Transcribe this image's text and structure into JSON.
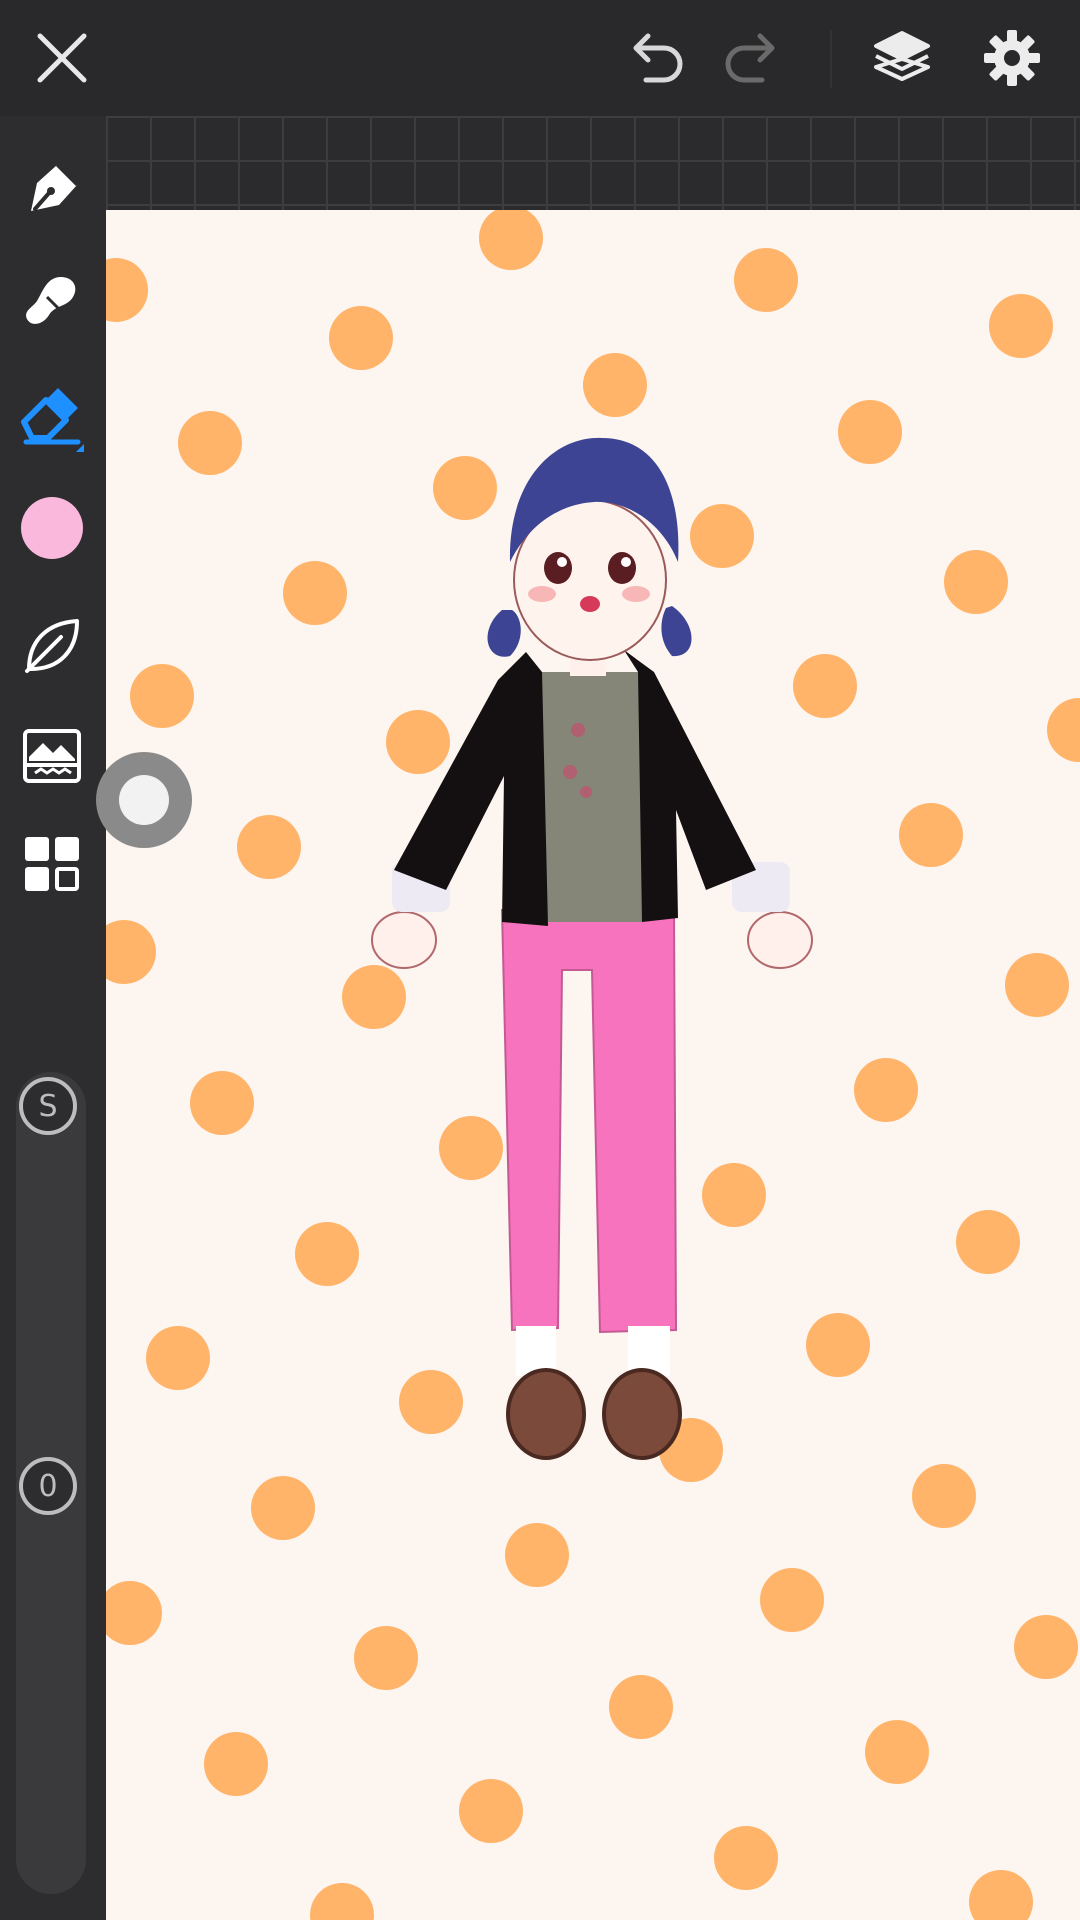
{
  "topbar": {
    "close_icon": "close-icon",
    "undo_icon": "undo-icon",
    "redo_icon": "redo-icon",
    "layers_icon": "layers-icon",
    "settings_icon": "gear-icon"
  },
  "tools": [
    {
      "name": "pen",
      "icon": "pen-icon"
    },
    {
      "name": "smudge",
      "icon": "smudge-icon"
    },
    {
      "name": "eraser",
      "icon": "eraser-icon",
      "selected": true
    },
    {
      "name": "color",
      "icon": "color-swatch",
      "color": "#f9b8dc"
    },
    {
      "name": "material",
      "icon": "leaf-icon"
    },
    {
      "name": "adjust",
      "icon": "image-filter-icon"
    },
    {
      "name": "more",
      "icon": "grid-menu-icon"
    }
  ],
  "sliders": {
    "size_label": "S",
    "opacity_label": "0"
  },
  "colors": {
    "accent": "#1e90ff",
    "toolbar_bg": "#2d2d2f",
    "topbar_bg": "#29292b",
    "canvas_bg": "#fdf5f0",
    "dots": "#ffb46a",
    "current_color": "#f9b8dc"
  }
}
